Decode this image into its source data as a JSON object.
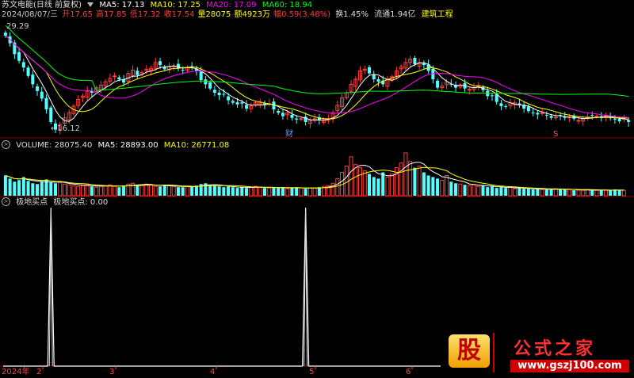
{
  "header": {
    "title": "苏文电能(日线 前复权)",
    "date": "2024/08/07/三",
    "open": "开17.65",
    "high": "高17.85",
    "low": "低17.32",
    "close": "收17.54",
    "vol": "量28075",
    "amount": "额4923万",
    "change": "幅0.59(3.48%)",
    "turnover": "换1.45%",
    "float": "流通1.94亿",
    "sector": "建筑工程"
  },
  "ma_legend": {
    "ma5": "MA5: 17.13",
    "ma10": "MA10: 17.25",
    "ma20": "MA20: 17.09",
    "ma60": "MA60: 18.94"
  },
  "volume_legend": {
    "vol": "VOLUME: 28075.40",
    "ma5": "MA5: 28893.00",
    "ma10": "MA10: 26771.08"
  },
  "indicator_legend": {
    "name": "极地买点",
    "value": "极地买点: 0.00"
  },
  "price_annotations": {
    "high_label": "29.29",
    "low_label": "←16.12",
    "marker_cai": "财",
    "marker_s": "S"
  },
  "x_axis": {
    "year": "2024年",
    "months": [
      "2",
      "3",
      "4",
      "5",
      "6"
    ]
  },
  "logo": {
    "gu": "股",
    "title": "公式之家",
    "url": "www.gszj100.com"
  },
  "colors": {
    "up": "#ff3c3c",
    "down": "#54ffff",
    "ma5": "#ffffff",
    "ma10": "#ffff00",
    "ma20": "#ff00ff",
    "ma60": "#00ff00",
    "grid": "#8b0000"
  },
  "chart_data": {
    "type": "candlestick",
    "price_range": [
      16.12,
      29.29
    ],
    "closes": [
      27.8,
      26.9,
      25.6,
      24.8,
      24.0,
      23.0,
      22.0,
      21.2,
      20.3,
      19.0,
      17.5,
      16.6,
      17.2,
      18.0,
      18.6,
      19.4,
      20.2,
      20.6,
      21.2,
      21.0,
      21.6,
      21.9,
      22.3,
      22.7,
      23.0,
      22.6,
      22.2,
      23.3,
      23.7,
      23.1,
      23.4,
      23.8,
      23.9,
      24.6,
      24.3,
      23.8,
      24.1,
      24.2,
      23.9,
      23.7,
      24.0,
      24.1,
      23.6,
      22.5,
      22.0,
      21.5,
      21.0,
      20.7,
      20.8,
      20.1,
      19.8,
      19.6,
      19.7,
      19.1,
      19.4,
      19.8,
      19.8,
      19.6,
      19.7,
      19.0,
      18.6,
      18.2,
      18.6,
      18.0,
      17.8,
      17.9,
      17.5,
      17.7,
      17.9,
      17.7,
      17.8,
      17.9,
      18.6,
      19.5,
      20.4,
      21.0,
      22.0,
      22.6,
      23.6,
      23.8,
      23.3,
      22.6,
      22.3,
      22.0,
      22.6,
      22.9,
      23.6,
      24.1,
      24.6,
      25.0,
      24.4,
      24.6,
      24.3,
      23.6,
      22.6,
      21.6,
      21.8,
      22.3,
      22.0,
      21.6,
      21.9,
      21.5,
      21.4,
      21.6,
      21.9,
      21.3,
      20.6,
      20.6,
      19.9,
      19.4,
      19.3,
      19.8,
      19.8,
      19.5,
      19.1,
      18.8,
      18.6,
      18.4,
      18.6,
      18.3,
      18.0,
      18.1,
      18.3,
      18.0,
      18.1,
      17.9,
      17.7,
      17.9,
      18.1,
      18.3,
      18.2,
      18.0,
      18.3,
      18.0,
      17.8,
      17.6,
      17.9,
      17.5
    ],
    "volume_range": [
      0,
      60000
    ],
    "volumes": [
      26000,
      22000,
      18000,
      20000,
      24000,
      19000,
      16000,
      15000,
      18000,
      21000,
      17000,
      16000,
      17000,
      15000,
      14000,
      13000,
      12000,
      13000,
      14000,
      12000,
      11000,
      12000,
      13000,
      14000,
      12000,
      11000,
      13000,
      15000,
      16000,
      14000,
      13000,
      15000,
      14000,
      12000,
      12000,
      13000,
      13000,
      12000,
      11000,
      11000,
      12000,
      12000,
      13000,
      15000,
      16000,
      14000,
      13000,
      12000,
      11000,
      12000,
      11000,
      10000,
      11000,
      10000,
      11000,
      12000,
      11000,
      10000,
      10000,
      11000,
      10000,
      11000,
      9000,
      10000,
      11000,
      10000,
      9000,
      10000,
      10000,
      11000,
      12000,
      13000,
      16000,
      22000,
      30000,
      38000,
      50000,
      40000,
      36000,
      32000,
      28000,
      24000,
      22000,
      30000,
      24000,
      28000,
      36000,
      42000,
      55000,
      44000,
      36000,
      38000,
      30000,
      26000,
      24000,
      22000,
      20000,
      26000,
      18000,
      16000,
      15000,
      14000,
      13000,
      14000,
      12000,
      13000,
      11000,
      12000,
      10000,
      11000,
      10000,
      11000,
      9000,
      10000,
      9000,
      9000,
      8000,
      9000,
      8000,
      8000,
      8000,
      9000,
      8000,
      8000,
      8000,
      7000,
      7000,
      7000,
      8000,
      7000,
      7000,
      7000,
      7000,
      7000,
      8000,
      7000,
      7000
    ],
    "signal_spikes": [
      10,
      66
    ],
    "signal_range": [
      0,
      1
    ]
  }
}
